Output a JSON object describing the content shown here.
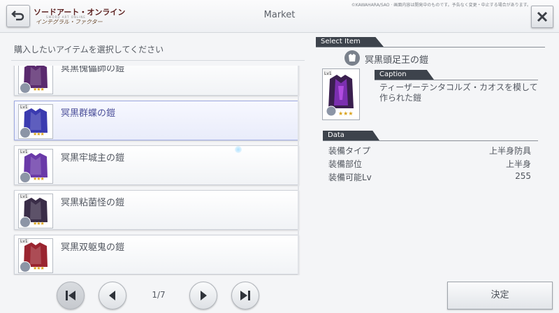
{
  "header": {
    "title": "Market",
    "logo_title": "ソードアート・オンライン",
    "logo_sub": "SWORD ART ONLINE",
    "logo_subtitle": "インテグラル・ファクター",
    "copyright": "©KAWAHARA/SAO · 画面内容は開発中のものです。予告なく変更・中止する場合があります。"
  },
  "instruction": "購入したいアイテムを選択してください",
  "list": {
    "items": [
      {
        "name": "冥黒傀儡師の鎧",
        "selected": false,
        "color": "#5a2a6e"
      },
      {
        "name": "冥黒群蝶の鎧",
        "selected": true,
        "color": "#3b3bb0"
      },
      {
        "name": "冥黒牢城主の鎧",
        "selected": false,
        "color": "#6a3aa8"
      },
      {
        "name": "冥黒粘菌怪の鎧",
        "selected": false,
        "color": "#3a2d48"
      },
      {
        "name": "冥黒双躯鬼の鎧",
        "selected": false,
        "color": "#9a2530"
      }
    ],
    "lv_label": "Lv1"
  },
  "pager": {
    "page": "1/7"
  },
  "select_item": {
    "label": "Select Item",
    "name": "冥黒頭足王の鎧",
    "caption_label": "Caption",
    "caption": "ティーザーテンタコルズ・カオスを模して作られた鎧"
  },
  "data_section": {
    "label": "Data",
    "rows": [
      {
        "key": "装備タイプ",
        "value": "上半身防具"
      },
      {
        "key": "装備部位",
        "value": "上半身"
      },
      {
        "key": "装備可能Lv",
        "value": "255"
      }
    ]
  },
  "confirm_label": "決定",
  "colors": {
    "accent": "#3d434c",
    "selected_border": "#9ea9e0",
    "star": "#d9a21b"
  }
}
